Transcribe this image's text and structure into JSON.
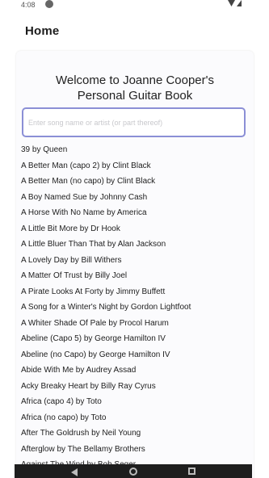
{
  "status_bar": {
    "time": "4:08"
  },
  "app_bar": {
    "title": "Home"
  },
  "welcome": {
    "line1": "Welcome to Joanne Cooper's",
    "line2": "Personal Guitar Book"
  },
  "search": {
    "placeholder": "Enter song name or artist (or part thereof)",
    "value": ""
  },
  "songs": [
    "39 by Queen",
    "A Better Man (capo 2) by Clint Black",
    "A Better Man (no capo) by Clint Black",
    "A Boy Named Sue by Johnny Cash",
    "A Horse With No Name by America",
    "A Little Bit More by Dr Hook",
    "A Little Bluer Than That by Alan Jackson",
    "A Lovely Day by Bill Withers",
    "A Matter Of Trust  by Billy Joel",
    "A Pirate Looks At Forty by Jimmy Buffett",
    "A Song for a Winter's Night by Gordon Lightfoot",
    "A Whiter Shade Of Pale by Procol Harum",
    "Abeline (Capo 5) by George Hamilton IV",
    "Abeline (no Capo) by George Hamilton IV",
    "Abide With Me by Audrey Assad",
    "Acky Breaky Heart by Billy Ray Cyrus",
    "Africa (capo 4) by Toto",
    "Africa (no capo) by Toto",
    "After The Goldrush by Neil Young",
    "Afterglow by The Bellamy Brothers",
    "Against The Wind by Bob Seger"
  ]
}
